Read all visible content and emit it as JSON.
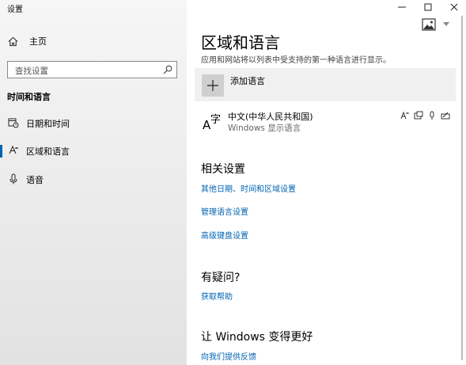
{
  "window": {
    "title": "设置",
    "controls": {
      "minimize": "—",
      "maximize": "☐",
      "close": "✕"
    }
  },
  "sidebar": {
    "home_label": "主页",
    "search_placeholder": "查找设置",
    "group_title": "时间和语言",
    "items": [
      {
        "label": "日期和时间",
        "icon": "calendar-clock-icon",
        "active": false
      },
      {
        "label": "区域和语言",
        "icon": "region-language-icon",
        "active": true
      },
      {
        "label": "语音",
        "icon": "microphone-icon",
        "active": false
      }
    ]
  },
  "main": {
    "title": "区域和语言",
    "description": "应用和网站将以列表中受支持的第一种语言进行显示。",
    "add_language_label": "添加语言",
    "language": {
      "name": "中文(中华人民共和国)",
      "subtitle": "Windows 显示语言",
      "glyph_a": "A",
      "glyph_char": "字",
      "feature_icons": [
        "display-language-icon",
        "text-to-speech-icon",
        "speech-recognition-icon",
        "handwriting-icon"
      ]
    },
    "related": {
      "heading": "相关设置",
      "links": [
        "其他日期、时间和区域设置",
        "管理语言设置",
        "高级键盘设置"
      ]
    },
    "question": {
      "heading": "有疑问?",
      "link": "获取帮助"
    },
    "improve": {
      "heading": "让 Windows 变得更好",
      "link": "向我们提供反馈"
    }
  },
  "colors": {
    "accent": "#0063b1",
    "sidebar_bg": "#ececec"
  }
}
